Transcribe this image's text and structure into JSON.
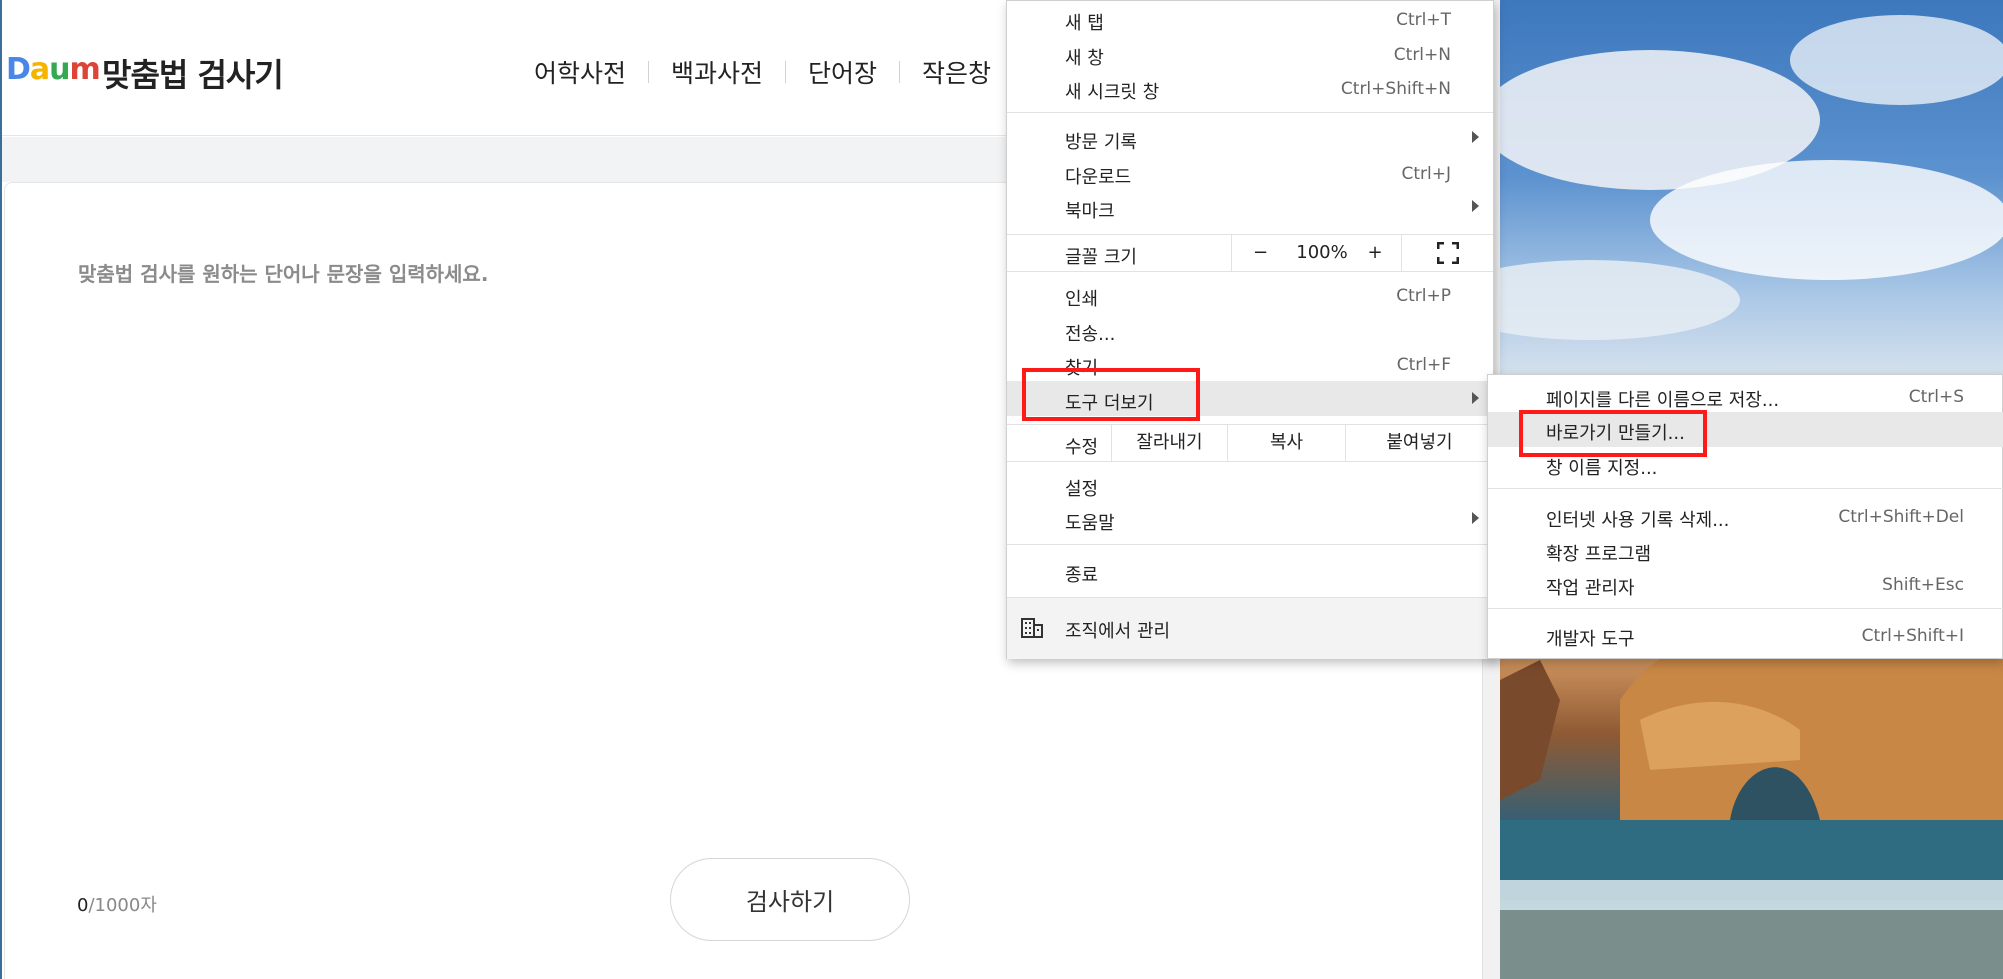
{
  "site": {
    "logo": [
      "D",
      "a",
      "u",
      "m"
    ],
    "title": "맞춤법 검사기",
    "nav": [
      "어학사전",
      "백과사전",
      "단어장",
      "작은창"
    ]
  },
  "editor": {
    "prompt": "맞춤법 검사를 원하는 단어나 문장을 입력하세요.",
    "count_current": "0",
    "count_max": "/1000자",
    "search_button": "검사하기"
  },
  "menu": {
    "new_tab": {
      "label": "새 탭",
      "shortcut": "Ctrl+T"
    },
    "new_window": {
      "label": "새 창",
      "shortcut": "Ctrl+N"
    },
    "incognito": {
      "label": "새 시크릿 창",
      "shortcut": "Ctrl+Shift+N"
    },
    "history": {
      "label": "방문 기록"
    },
    "downloads": {
      "label": "다운로드",
      "shortcut": "Ctrl+J"
    },
    "bookmarks": {
      "label": "북마크"
    },
    "zoom": {
      "label": "글꼴 크기",
      "minus": "−",
      "value": "100%",
      "plus": "+"
    },
    "print": {
      "label": "인쇄",
      "shortcut": "Ctrl+P"
    },
    "cast": {
      "label": "전송..."
    },
    "find": {
      "label": "찾기",
      "shortcut": "Ctrl+F"
    },
    "more_tools": {
      "label": "도구 더보기"
    },
    "edit": {
      "label": "수정",
      "cut": "잘라내기",
      "copy": "복사",
      "paste": "붙여넣기"
    },
    "settings": {
      "label": "설정"
    },
    "help": {
      "label": "도움말"
    },
    "exit": {
      "label": "종료"
    },
    "managed": {
      "label": "조직에서 관리"
    }
  },
  "submenu": {
    "save_as": {
      "label": "페이지를 다른 이름으로 저장...",
      "shortcut": "Ctrl+S"
    },
    "create_shortcut": {
      "label": "바로가기 만들기..."
    },
    "name_window": {
      "label": "창 이름 지정..."
    },
    "clear_data": {
      "label": "인터넷 사용 기록 삭제...",
      "shortcut": "Ctrl+Shift+Del"
    },
    "extensions": {
      "label": "확장 프로그램"
    },
    "task_manager": {
      "label": "작업 관리자",
      "shortcut": "Shift+Esc"
    },
    "dev_tools": {
      "label": "개발자 도구",
      "shortcut": "Ctrl+Shift+I"
    }
  },
  "colors": {
    "highlight_box": "#ff1a1a",
    "menu_hover": "#e8e8e8"
  }
}
